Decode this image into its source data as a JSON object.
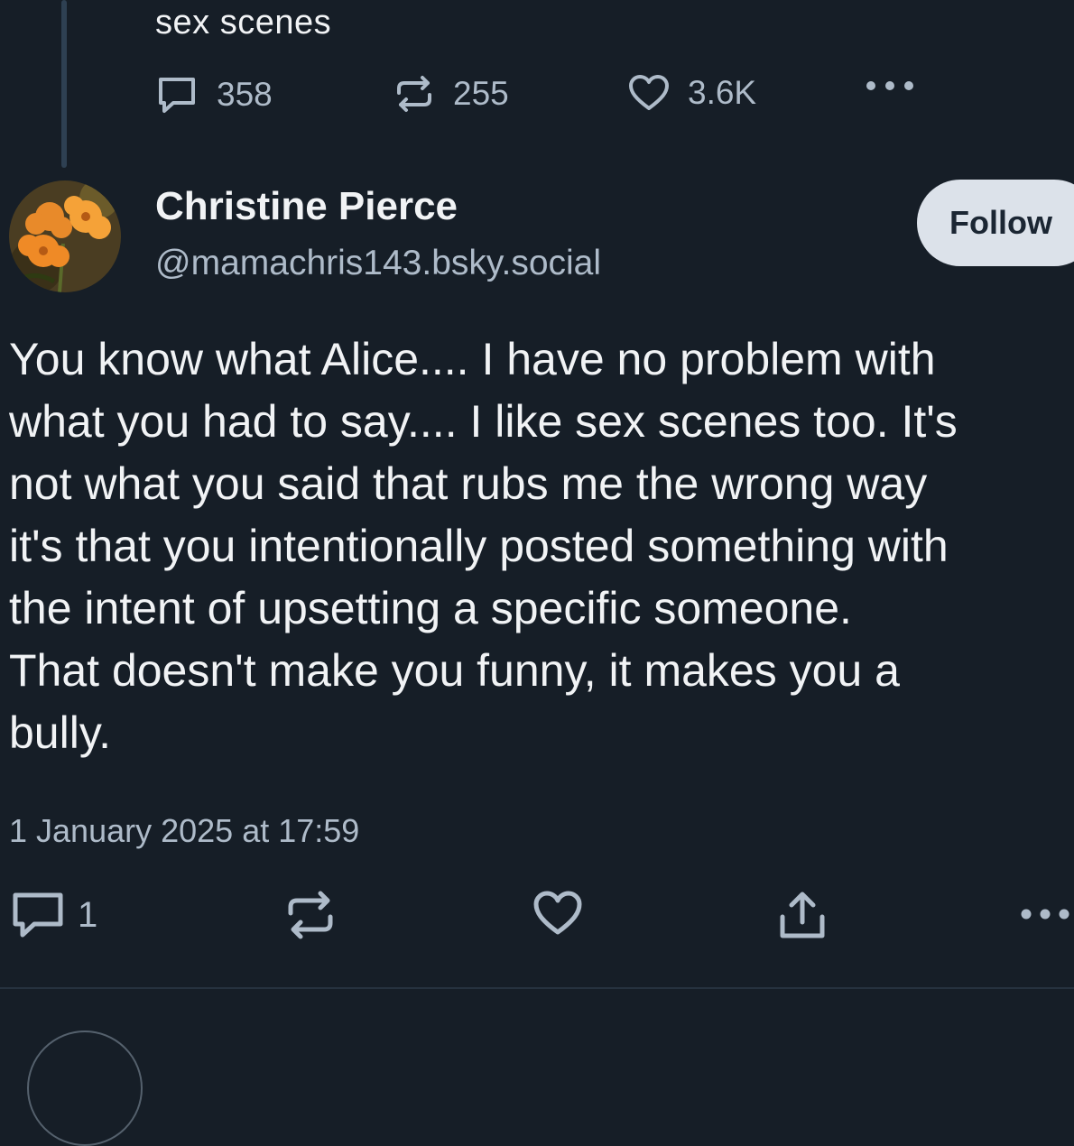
{
  "previous_post": {
    "text_tail": "sex scenes",
    "reply_count": "358",
    "repost_count": "255",
    "like_count": "3.6K",
    "icons": [
      "reply-icon",
      "repost-icon",
      "like-icon",
      "more-icon"
    ]
  },
  "post": {
    "author_name": "Christine Pierce",
    "author_handle": "@mamachris143.bsky.social",
    "follow_label": "Follow",
    "body": "You know what Alice.... I have no problem with\nwhat you had to say.... I like sex scenes too. It's\nnot what you said that rubs me the wrong way\nit's that you intentionally posted something with\nthe intent of upsetting a specific someone.\nThat doesn't make you funny, it makes you a\nbully.",
    "timestamp": "1 January 2025 at 17:59",
    "reply_count": "1",
    "icons": [
      "reply-icon",
      "repost-icon",
      "like-icon",
      "share-icon",
      "more-icon"
    ]
  },
  "colors": {
    "background": "#161e27",
    "text_primary": "#f1f3f5",
    "text_secondary": "#aebbc9",
    "follow_button_bg": "#dce2ea",
    "thread_line": "#2e4052"
  }
}
